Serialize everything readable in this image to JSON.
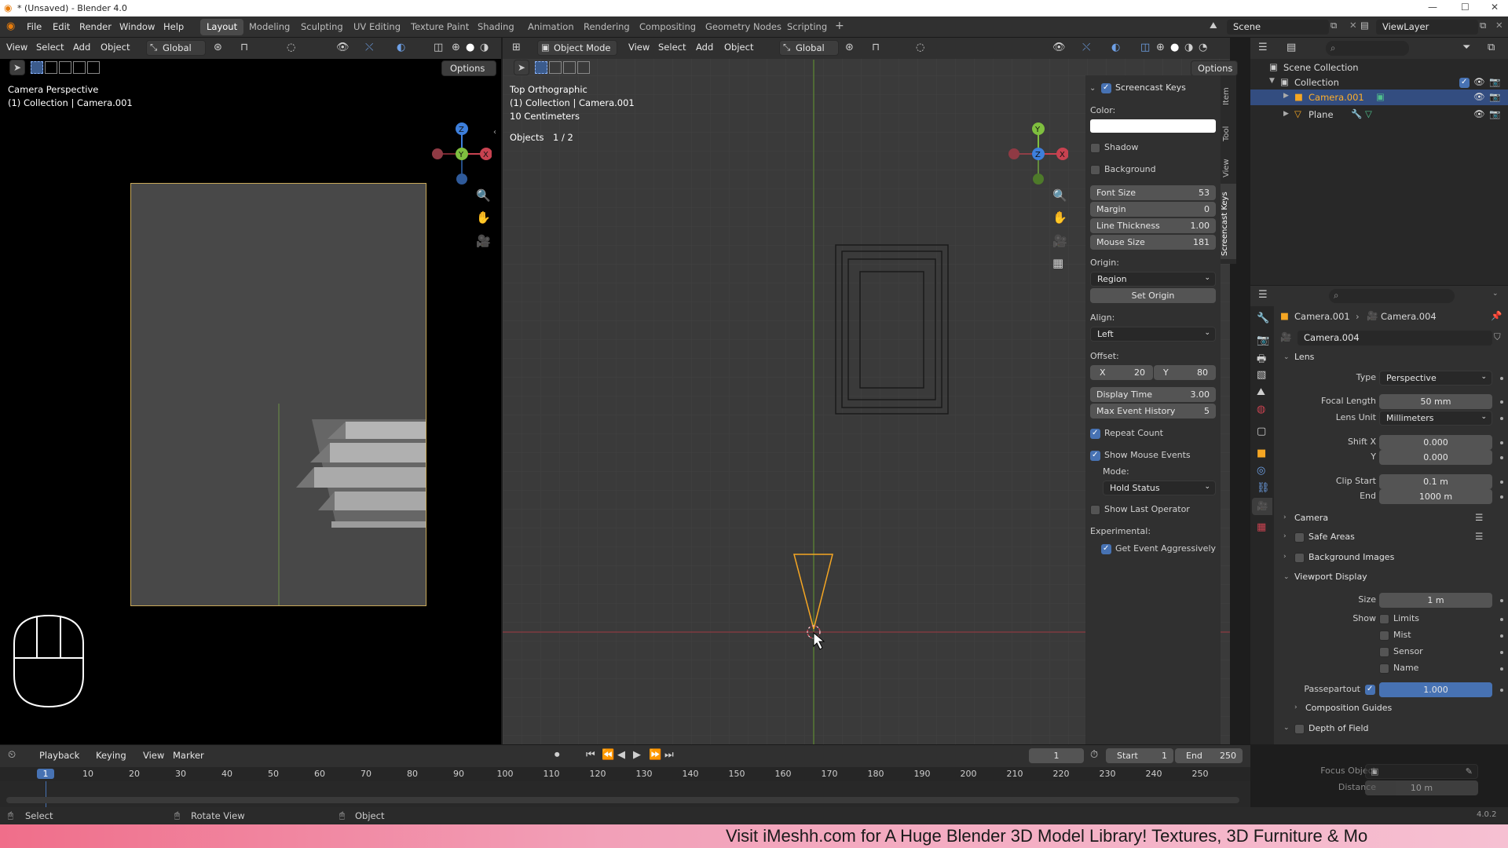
{
  "app": {
    "title": "* (Unsaved) - Blender 4.0"
  },
  "menus": [
    "File",
    "Edit",
    "Render",
    "Window",
    "Help"
  ],
  "workspaces": [
    "Layout",
    "Modeling",
    "Sculpting",
    "UV Editing",
    "Texture Paint",
    "Shading",
    "Animation",
    "Rendering",
    "Compositing",
    "Geometry Nodes",
    "Scripting"
  ],
  "top_right": {
    "scene": "Scene",
    "view_layer": "ViewLayer"
  },
  "left_viewport": {
    "menus": [
      "View",
      "Select",
      "Add",
      "Object"
    ],
    "transform": "Global",
    "options": "Options",
    "overlay_title": "Camera Perspective",
    "overlay_sub": "(1) Collection | Camera.001"
  },
  "main_viewport": {
    "mode": "Object Mode",
    "menus": [
      "View",
      "Select",
      "Add",
      "Object"
    ],
    "transform": "Global",
    "options": "Options",
    "overlay_title": "Top Orthographic",
    "overlay_sub": "(1) Collection | Camera.001",
    "overlay_scale": "10 Centimeters",
    "objects_label": "Objects",
    "objects_count": "1 / 2"
  },
  "sidebar_tabs": [
    "Item",
    "Tool",
    "View",
    "Screencast Keys"
  ],
  "screencast": {
    "header": "Screencast Keys",
    "color_label": "Color:",
    "shadow": "Shadow",
    "background": "Background",
    "font_size_label": "Font Size",
    "font_size": "53",
    "margin_label": "Margin",
    "margin": "0",
    "line_thickness_label": "Line Thickness",
    "line_thickness": "1.00",
    "mouse_size_label": "Mouse Size",
    "mouse_size": "181",
    "origin_label": "Origin:",
    "origin": "Region",
    "set_origin": "Set Origin",
    "align_label": "Align:",
    "align": "Left",
    "offset_label": "Offset:",
    "offset_x_label": "X",
    "offset_x": "20",
    "offset_y_label": "Y",
    "offset_y": "80",
    "display_time_label": "Display Time",
    "display_time": "3.00",
    "max_event_label": "Max Event History",
    "max_event": "5",
    "repeat_count": "Repeat Count",
    "show_mouse_events": "Show Mouse Events",
    "mode_label": "Mode:",
    "mode": "Hold Status",
    "show_last_operator": "Show Last Operator",
    "experimental_label": "Experimental:",
    "get_event": "Get Event Aggressively"
  },
  "outliner": {
    "scene_collection": "Scene Collection",
    "collection": "Collection",
    "items": [
      "Camera.001",
      "Plane"
    ]
  },
  "properties": {
    "breadcrumb_obj": "Camera.001",
    "breadcrumb_data": "Camera.004",
    "datablock": "Camera.004",
    "lens_section": "Lens",
    "type_label": "Type",
    "type": "Perspective",
    "focal_label": "Focal Length",
    "focal": "50 mm",
    "lens_unit_label": "Lens Unit",
    "lens_unit": "Millimeters",
    "shiftx_label": "Shift X",
    "shiftx": "0.000",
    "shifty_label": "Y",
    "shifty": "0.000",
    "clip_start_label": "Clip Start",
    "clip_start": "0.1 m",
    "clip_end_label": "End",
    "clip_end": "1000 m",
    "camera_section": "Camera",
    "safe_areas": "Safe Areas",
    "bg_images": "Background Images",
    "viewport_display": "Viewport Display",
    "size_label": "Size",
    "size": "1 m",
    "show_label": "Show",
    "limits": "Limits",
    "mist": "Mist",
    "sensor": "Sensor",
    "name": "Name",
    "passepartout_label": "Passepartout",
    "passepartout": "1.000",
    "passepartout_fill": 1.0,
    "comp_guides": "Composition Guides",
    "dof": "Depth of Field",
    "focus_obj_label": "Focus Object",
    "distance_label": "Distance",
    "distance": "10 m"
  },
  "timeline": {
    "menus": [
      "Playback",
      "Keying",
      "View",
      "Marker"
    ],
    "current_frame": "1",
    "start_label": "Start",
    "start": "1",
    "end_label": "End",
    "end": "250",
    "ticks": [
      "1",
      "10",
      "20",
      "30",
      "40",
      "50",
      "60",
      "70",
      "80",
      "90",
      "100",
      "110",
      "120",
      "130",
      "140",
      "150",
      "160",
      "170",
      "180",
      "190",
      "200",
      "210",
      "220",
      "230",
      "240",
      "250"
    ]
  },
  "statusbar": {
    "select": "Select",
    "rotate": "Rotate View",
    "object": "Object",
    "version": "4.0.2"
  },
  "banner": {
    "text": "Visit iMeshh.com for A Huge Blender 3D Model Library! Textures, 3D Furniture & Mo"
  },
  "colors": {
    "accent": "#4772b3",
    "selection": "#f5a623",
    "x_axis": "#c84250",
    "y_axis": "#7fbf3f",
    "z_axis": "#3d7fdc"
  }
}
